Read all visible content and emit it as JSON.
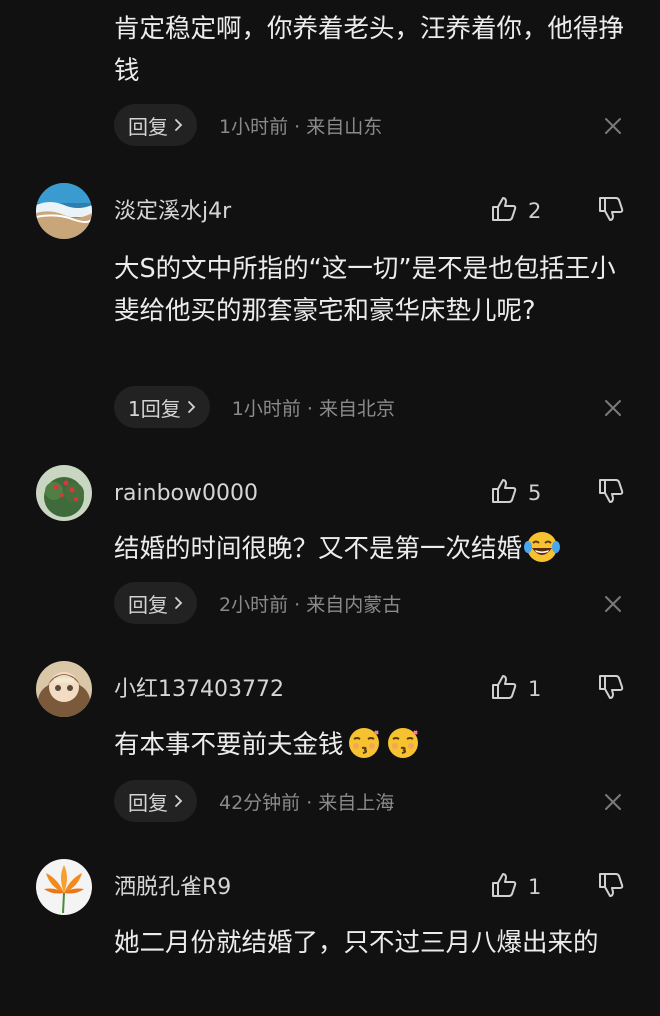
{
  "comments": [
    {
      "text": "肯定稳定啊，你养着老头，汪养着你，他得挣钱",
      "reply_label": "回复",
      "time": "1小时前 · 来自山东"
    },
    {
      "username": "淡定溪水j4r",
      "like_count": "2",
      "text": "大S的文中所指的“这一切”是不是也包括王小斐给他买的那套豪宅和豪华床垫儿呢?",
      "reply_label": "1回复",
      "time": "1小时前 · 来自北京",
      "avatar_icon": "ocean-beach-avatar"
    },
    {
      "username": "rainbow0000",
      "like_count": "5",
      "text": "结婚的时间很晚？又不是第一次结婚",
      "emoji": [
        "laughing-tears-emoji"
      ],
      "reply_label": "回复",
      "time": "2小时前 · 来自内蒙古",
      "avatar_icon": "flower-bush-avatar"
    },
    {
      "username": "小红137403772",
      "like_count": "1",
      "text": "有本事不要前夫金钱",
      "emoji": [
        "kissing-emoji",
        "kissing-emoji"
      ],
      "reply_label": "回复",
      "time": "42分钟前 · 来自上海",
      "avatar_icon": "doll-avatar"
    },
    {
      "username": "洒脱孔雀R9",
      "like_count": "1",
      "text": "她二月份就结婚了，只不过三月八爆出来的",
      "avatar_icon": "orange-lily-avatar"
    }
  ],
  "colors": {
    "background": "#111111",
    "text": "#ececec",
    "meta": "#8a8a8a",
    "reply_bg": "#222222"
  }
}
